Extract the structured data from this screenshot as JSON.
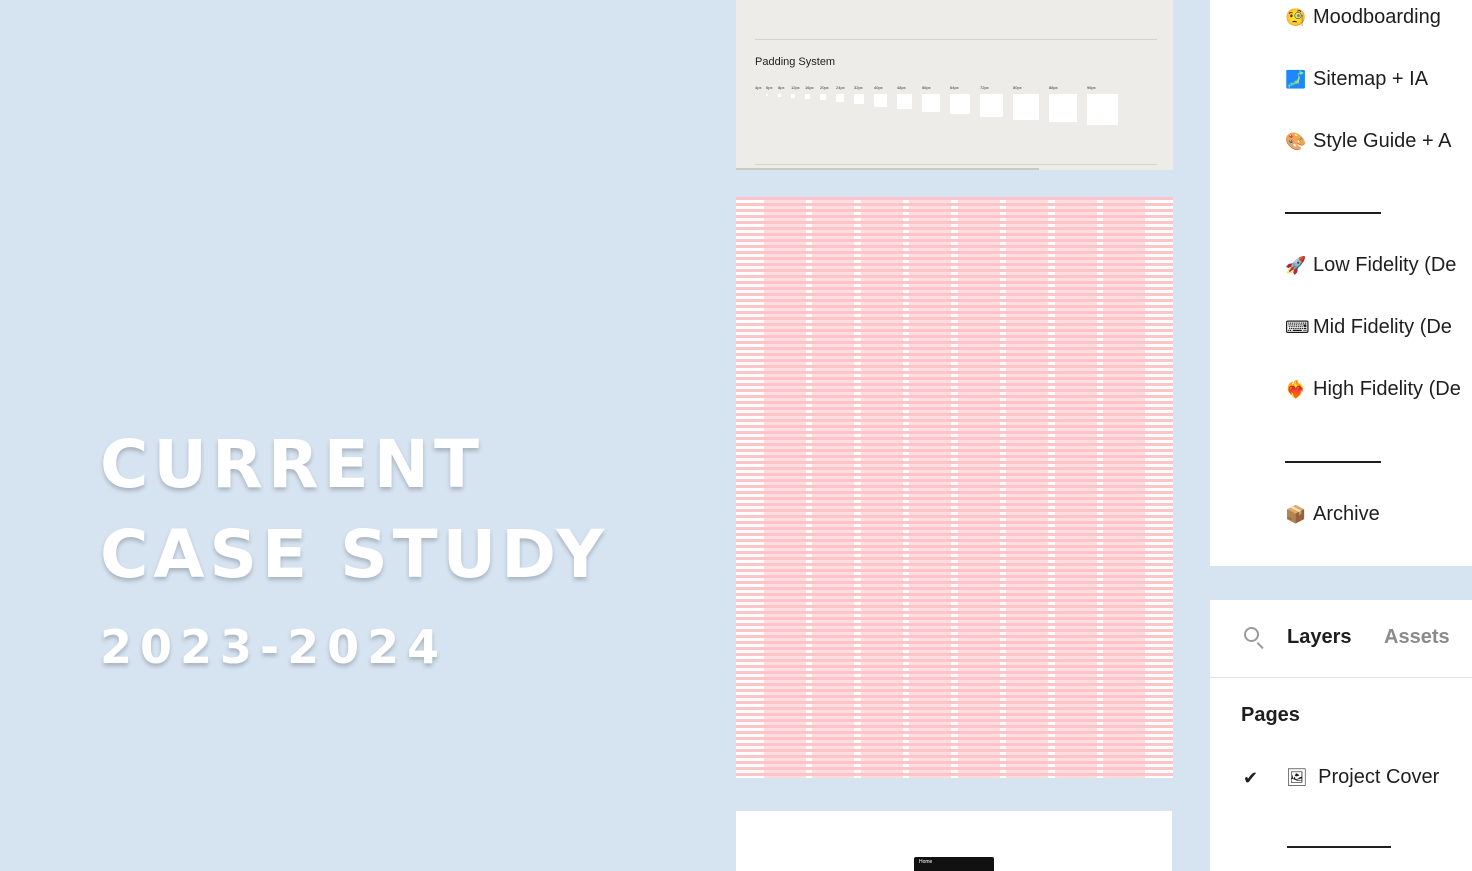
{
  "hero": {
    "line1": "CURRENT",
    "line2": "CASE STUDY",
    "years": "2023-2024"
  },
  "padding_card": {
    "title": "Padding System",
    "sizes": [
      "4px",
      "6px",
      "8px",
      "12px",
      "16px",
      "20px",
      "24px",
      "32px",
      "40px",
      "48px",
      "56px",
      "64px",
      "72px",
      "80px",
      "88px",
      "96px"
    ]
  },
  "preview": {
    "nav_label": "Home"
  },
  "pages_panel": {
    "items": [
      {
        "icon": "🧐",
        "label": "Moodboarding"
      },
      {
        "icon": "🗾",
        "label": "Sitemap + IA"
      },
      {
        "icon": "🎨",
        "label": " Style Guide + A"
      },
      {
        "icon": "🚀",
        "label": "Low Fidelity (De"
      },
      {
        "icon": "⌨",
        "label": "Mid Fidelity (De"
      },
      {
        "icon": "❤️‍🔥",
        "label": "High Fidelity (De"
      },
      {
        "icon": "📦",
        "label": "Archive"
      }
    ]
  },
  "layers_panel": {
    "tabs": {
      "layers": "Layers",
      "assets": "Assets"
    },
    "section_title": "Pages",
    "current_page": {
      "icon": "🖼",
      "label": "Project Cover",
      "check": "✔"
    }
  },
  "colors": {
    "background": "#d6e4f2",
    "grid_pink": "#ffc4c8",
    "card_bg": "#edece8"
  }
}
